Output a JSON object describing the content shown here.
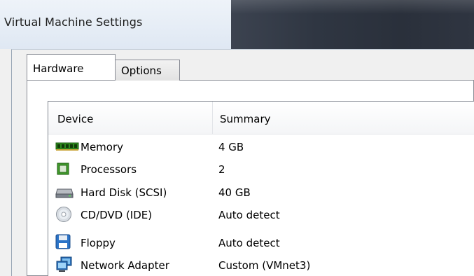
{
  "window": {
    "title": "Virtual Machine Settings"
  },
  "tabs": [
    {
      "label": "Hardware",
      "active": true
    },
    {
      "label": "Options",
      "active": false
    }
  ],
  "device_list": {
    "columns": [
      "Device",
      "Summary"
    ],
    "rows": [
      {
        "device": "Memory",
        "summary": "4 GB",
        "icon": "memory-icon"
      },
      {
        "device": "Processors",
        "summary": "2",
        "icon": "processor-icon"
      },
      {
        "device": "Hard Disk (SCSI)",
        "summary": "40 GB",
        "icon": "hard-disk-icon"
      },
      {
        "device": "CD/DVD (IDE)",
        "summary": "Auto detect",
        "icon": "cd-dvd-icon"
      },
      {
        "device": "Floppy",
        "summary": "Auto detect",
        "icon": "floppy-icon"
      },
      {
        "device": "Network Adapter",
        "summary": "Custom (VMnet3)",
        "icon": "network-adapter-icon"
      }
    ]
  },
  "colors": {
    "titlebar_dark": "#2f3642",
    "titlebar_light": "#e3ebf5",
    "window_bg": "#f0f0f0",
    "panel_border": "#898c95"
  }
}
